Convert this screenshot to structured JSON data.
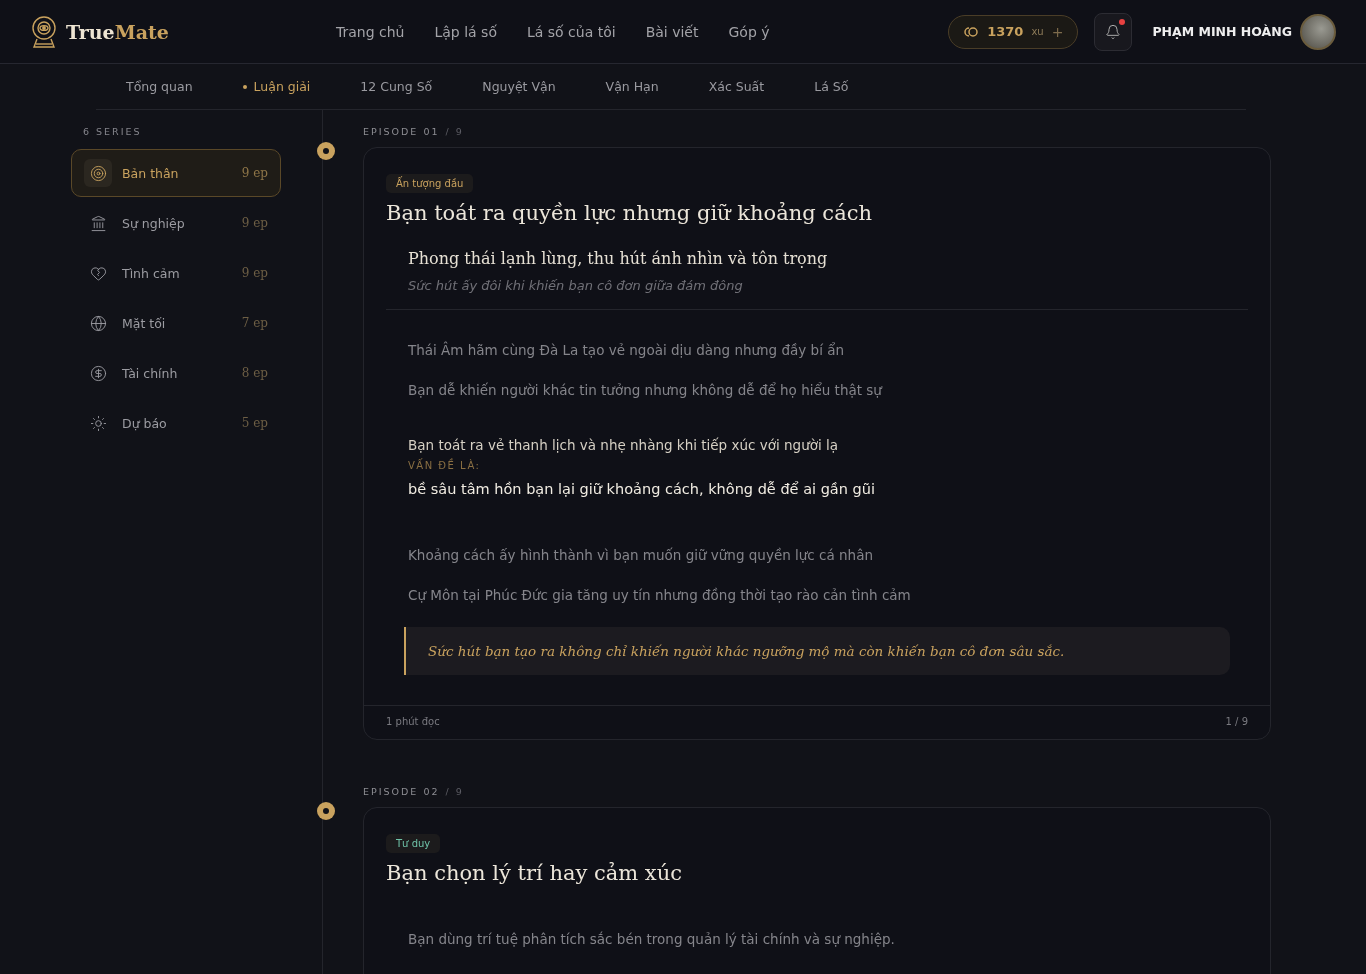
{
  "brand": {
    "first": "True",
    "second": "Mate"
  },
  "nav": [
    {
      "label": "Trang chủ"
    },
    {
      "label": "Lập lá số"
    },
    {
      "label": "Lá số của tôi"
    },
    {
      "label": "Bài viết"
    },
    {
      "label": "Góp ý"
    }
  ],
  "coins": {
    "amount": "1370",
    "unit": "xu",
    "add": "+"
  },
  "notifications": {
    "unread": true
  },
  "user": {
    "name": "PHẠM MINH HOÀNG"
  },
  "tabs": [
    {
      "label": "Tổng quan",
      "selected": false
    },
    {
      "label": "Luận giải",
      "selected": true
    },
    {
      "label": "12 Cung Số",
      "selected": false
    },
    {
      "label": "Nguyệt Vận",
      "selected": false
    },
    {
      "label": "Vận Hạn",
      "selected": false
    },
    {
      "label": "Xác Suất",
      "selected": false
    },
    {
      "label": "Lá Số",
      "selected": false
    }
  ],
  "sidebar": {
    "heading": "6 SERIES",
    "items": [
      {
        "label": "Bản thân",
        "count": "9 ep",
        "selected": true
      },
      {
        "label": "Sự nghiệp",
        "count": "9 ep",
        "selected": false
      },
      {
        "label": "Tình cảm",
        "count": "9 ep",
        "selected": false
      },
      {
        "label": "Mặt tối",
        "count": "7 ep",
        "selected": false
      },
      {
        "label": "Tài chính",
        "count": "8 ep",
        "selected": false
      },
      {
        "label": "Dự báo",
        "count": "5 ep",
        "selected": false
      }
    ]
  },
  "episodes": [
    {
      "label": "EPISODE 01",
      "total": "/ 9",
      "tag": {
        "text": "Ấn tượng đầu",
        "color": "#c9a25e"
      },
      "title": "Bạn toát ra quyền lực nhưng giữ khoảng cách",
      "subtitle": "Phong thái lạnh lùng, thu hút ánh nhìn và tôn trọng",
      "caption": "Sức hút ấy đôi khi khiến bạn cô đơn giữa đám đông",
      "body": [
        [
          {
            "kind": "text",
            "text": "Thái Âm hãm cùng Đà La tạo vẻ ngoài dịu dàng nhưng đầy bí ẩn"
          },
          {
            "kind": "text",
            "text": "Bạn dễ khiến người khác tin tưởng nhưng không dễ để họ hiểu thật sự"
          }
        ],
        [
          {
            "kind": "lead",
            "text": "Bạn toát ra vẻ thanh lịch và nhẹ nhàng khi tiếp xúc với người lạ"
          },
          {
            "kind": "label",
            "text": "VẤN ĐỀ LÀ:"
          },
          {
            "kind": "emphasis",
            "text": "bề sâu tâm hồn bạn lại giữ khoảng cách, không dễ để ai gần gũi"
          }
        ],
        [
          {
            "kind": "text",
            "text": "Khoảng cách ấy hình thành vì bạn muốn giữ vững quyền lực cá nhân"
          },
          {
            "kind": "text",
            "text": "Cự Môn tại Phúc Đức gia tăng uy tín nhưng đồng thời tạo rào cản tình cảm"
          },
          {
            "kind": "quote",
            "text": "Sức hút bạn tạo ra không chỉ khiến người khác ngưỡng mộ mà còn khiến bạn cô đơn sâu sắc."
          }
        ]
      ],
      "footer": {
        "read_time": "1 phút đọc",
        "page": "1 / 9"
      }
    },
    {
      "label": "EPISODE 02",
      "total": "/ 9",
      "tag": {
        "text": "Tư duy",
        "color": "#6fc2a8"
      },
      "title": "Bạn chọn lý trí hay cảm xúc",
      "body": [
        [
          {
            "kind": "text",
            "text": "Bạn dùng trí tuệ phân tích sắc bén trong quản lý tài chính và sự nghiệp."
          }
        ]
      ]
    }
  ]
}
